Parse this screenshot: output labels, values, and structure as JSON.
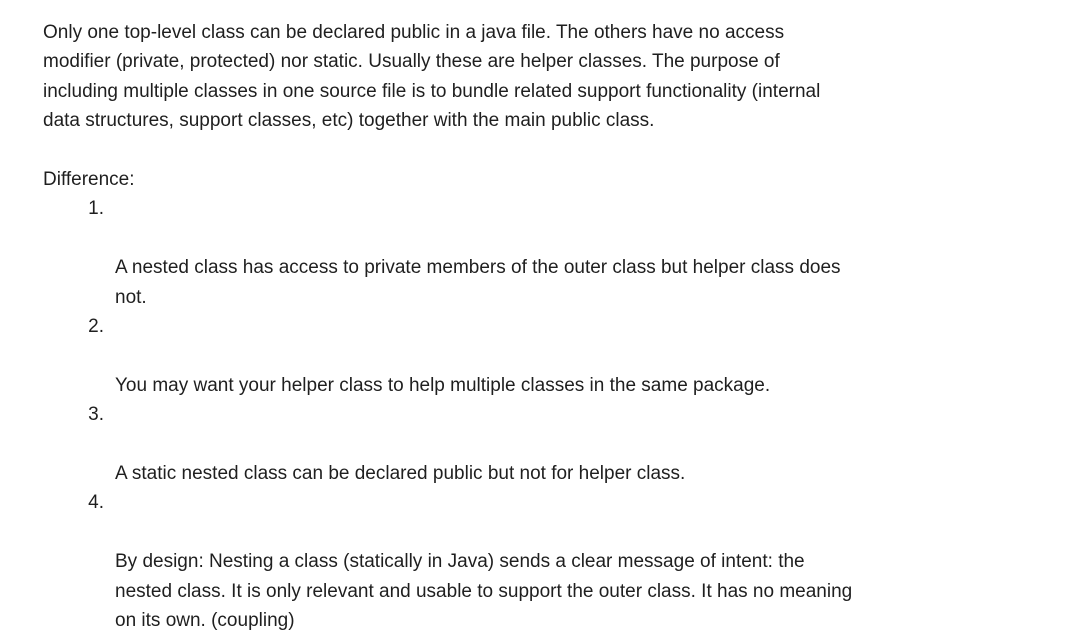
{
  "document": {
    "intro": "Only one top-level class can be declared public in a java file. The others have no access\nmodifier (private, protected) nor static. Usually these are helper classes. The purpose of\nincluding multiple classes in one source file is to bundle related support functionality (internal\ndata structures, support classes, etc) together with the main public class.",
    "heading": "Difference:",
    "items": [
      {
        "number": "1.",
        "text": "A nested class has access to private members of the outer class but helper class does\nnot."
      },
      {
        "number": "2.",
        "text": "You may want your helper class to help multiple classes in the same package."
      },
      {
        "number": "3.",
        "text": "A static nested class can be declared public but not for helper class."
      },
      {
        "number": "4.",
        "text": "By design:  Nesting a class (statically in Java) sends a clear message of intent: the\nnested class. It is only relevant and usable to support the outer class. It has no meaning\non its own. (coupling)"
      }
    ]
  }
}
